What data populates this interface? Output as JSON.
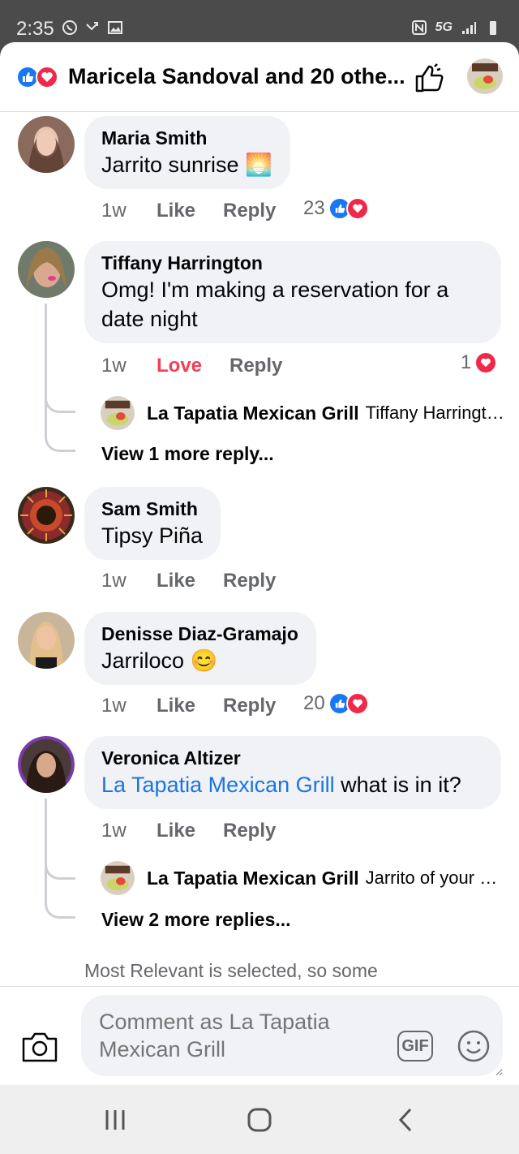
{
  "status_bar": {
    "time": "2:35",
    "network": "5G"
  },
  "header": {
    "title": "Maricela Sandoval and 20 othe...",
    "like_color": "#1877f2",
    "love_color": "#f02849",
    "icons": [
      "like-reaction-icon",
      "love-reaction-icon",
      "thumbs-up-outline-icon"
    ]
  },
  "comments": [
    {
      "author": "Maria Smith",
      "text": "Jarrito sunrise 🌅",
      "time": "1w",
      "like": "Like",
      "reply": "Reply",
      "reactions": "23"
    },
    {
      "author": "Tiffany Harrington",
      "text": "Omg! I'm making a reservation for a date night",
      "time": "1w",
      "like": "Love",
      "reply": "Reply",
      "reactions": "1",
      "reply_preview": {
        "author": "La Tapatia Mexican Grill",
        "snippet": "Tiffany Harrington"
      },
      "view_more": "View 1 more reply..."
    },
    {
      "author": "Sam Smith",
      "text": "Tipsy Piña",
      "time": "1w",
      "like": "Like",
      "reply": "Reply"
    },
    {
      "author": "Denisse Diaz-Gramajo",
      "text": "Jarriloco 😊",
      "time": "1w",
      "like": "Like",
      "reply": "Reply",
      "reactions": "20"
    },
    {
      "author": "Veronica Altizer",
      "mention": "La Tapatia Mexican Grill",
      "text": " what is in it?",
      "time": "1w",
      "like": "Like",
      "reply": "Reply",
      "reply_preview": {
        "author": "La Tapatia Mexican Grill",
        "snippet": "Jarrito of your choice"
      },
      "view_more": "View 2 more replies..."
    }
  ],
  "notice": "Most Relevant is selected, so some",
  "composer": {
    "placeholder": "Comment as La Tapatia Mexican Grill",
    "gif_label": "GIF"
  }
}
